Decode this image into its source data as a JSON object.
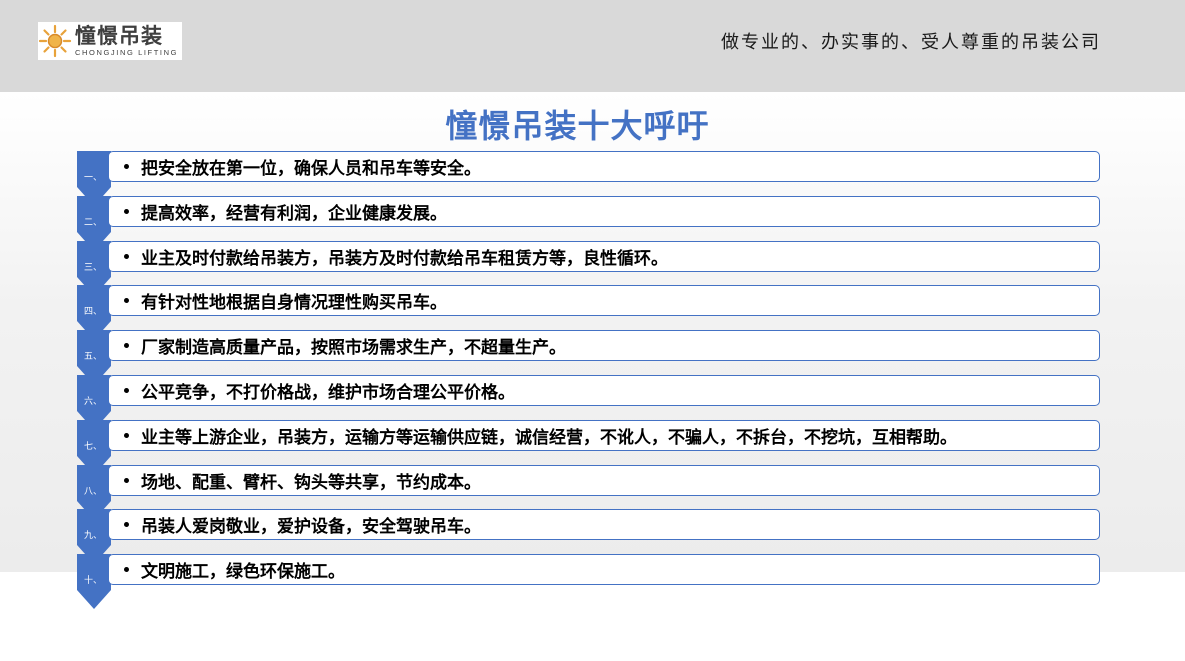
{
  "header": {
    "logo_cn": "憧憬吊装",
    "logo_en": "CHONGJING LIFTING",
    "slogan": "做专业的、办实事的、受人尊重的吊装公司"
  },
  "title": "憧憬吊装十大呼吁",
  "items": [
    {
      "num": "一、",
      "text": "把安全放在第一位，确保人员和吊车等安全。"
    },
    {
      "num": "二、",
      "text": "提高效率，经营有利润，企业健康发展。"
    },
    {
      "num": "三、",
      "text": "业主及时付款给吊装方，吊装方及时付款给吊车租赁方等，良性循环。"
    },
    {
      "num": "四、",
      "text": "有针对性地根据自身情况理性购买吊车。"
    },
    {
      "num": "五、",
      "text": "厂家制造高质量产品，按照市场需求生产，不超量生产。"
    },
    {
      "num": "六、",
      "text": "公平竞争，不打价格战，维护市场合理公平价格。"
    },
    {
      "num": "七、",
      "text": "业主等上游企业，吊装方，运输方等运输供应链，诚信经营，不讹人，不骗人，不拆台，不挖坑，互相帮助。"
    },
    {
      "num": "八、",
      "text": "场地、配重、臂杆、钩头等共享，节约成本。"
    },
    {
      "num": "九、",
      "text": "吊装人爱岗敬业，爱护设备，安全驾驶吊车。"
    },
    {
      "num": "十、",
      "text": "文明施工，绿色环保施工。"
    }
  ],
  "colors": {
    "accent": "#4472c4",
    "header_bg": "#d9d9d9"
  },
  "icons": {
    "logo": "sun-logo-icon",
    "bullet": "bullet-icon"
  }
}
